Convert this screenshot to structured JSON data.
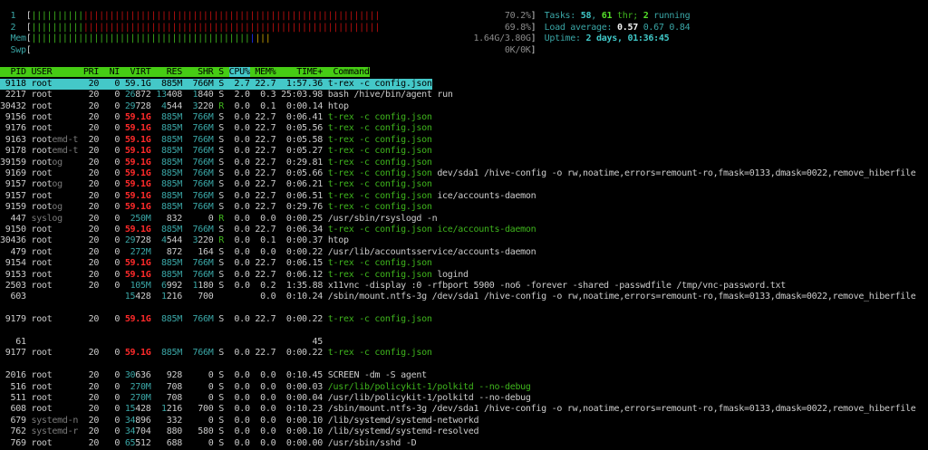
{
  "meters": {
    "cpu1": {
      "label": "1",
      "normal_pct": 10.4,
      "system_pct": 59.8,
      "text": "70.2%"
    },
    "cpu2": {
      "label": "2",
      "normal_pct": 10.4,
      "system_pct": 59.4,
      "text": "69.8%"
    },
    "mem": {
      "label": "Mem",
      "used_pct": 43.7,
      "buffers_pct": 1.0,
      "cache_pct": 3.1,
      "text": "1.64G/3.80G"
    },
    "swp": {
      "label": "Swp",
      "used_pct": 0,
      "text": "0K/0K"
    }
  },
  "summary": {
    "tasks_label": "Tasks: ",
    "tasks": "58",
    "thr": "61",
    "thr_label": " thr; ",
    "running": "2",
    "running_label": " running",
    "load_label": "Load average: ",
    "load1": "0.57",
    "load5": "0.67",
    "load15": "0.84",
    "uptime_label": "Uptime: ",
    "uptime": "2 days, 01:36:45"
  },
  "header": {
    "pid": "PID",
    "user": "USER",
    "pri": "PRI",
    "ni": "NI",
    "virt": "VIRT",
    "res": "RES",
    "shr": "SHR",
    "s": "S",
    "cpu": "CPU%",
    "mem": "MEM%",
    "time": "TIME+",
    "command": "Command"
  },
  "colors": {
    "header_bg": "#46cc14",
    "selected_bg": "#44c8c8",
    "thread": "#3fb51d",
    "big_mem": "#ff2a2a"
  },
  "processes": [
    {
      "line": 7,
      "selected": true,
      "pid": "9118",
      "user": "root",
      "pri": "20",
      "ni": "0",
      "virt": "59.1G",
      "res": "885M",
      "shr": "766M",
      "s": "S",
      "cpu": "2.7",
      "mem": "22.7",
      "time": "1:57.36",
      "cmd": "t-rex -c config.json"
    },
    {
      "line": 8,
      "pid": "2217",
      "user": "root",
      "pri": "20",
      "ni": "0",
      "virt": "26872",
      "res": "13408",
      "shr": "1840",
      "s": "S",
      "cpu": "2.0",
      "mem": "0.3",
      "time": "25:03.98",
      "cmd": "bash /hive/bin/agent run"
    },
    {
      "line": 9,
      "pid": "30432",
      "user": "root",
      "pri": "20",
      "ni": "0",
      "virt": "29728",
      "res": "4544",
      "shr": "3220",
      "s": "R",
      "cpu": "0.0",
      "mem": "0.1",
      "time": "0:00.14",
      "cmd": "htop"
    },
    {
      "line": 10,
      "thread": true,
      "pid": "9156",
      "user": "root",
      "pri": "20",
      "ni": "0",
      "virt": "59.1G",
      "res": "885M",
      "shr": "766M",
      "s": "S",
      "cpu": "0.0",
      "mem": "22.7",
      "time": "0:06.41",
      "cmd": "t-rex -c config.json"
    },
    {
      "line": 11,
      "thread": true,
      "pid": "9176",
      "user": "root",
      "pri": "20",
      "ni": "0",
      "virt": "59.1G",
      "res": "885M",
      "shr": "766M",
      "s": "S",
      "cpu": "0.0",
      "mem": "22.7",
      "time": "0:05.56",
      "cmd": "t-rex -c config.json"
    },
    {
      "line": 12,
      "thread": true,
      "pid": "9163",
      "user": "root",
      "user_ghost": "emd-t",
      "pri": "20",
      "ni": "0",
      "virt": "59.1G",
      "res": "885M",
      "shr": "766M",
      "s": "S",
      "cpu": "0.0",
      "mem": "22.7",
      "time": "0:05.58",
      "cmd": "t-rex -c config.json"
    },
    {
      "line": 13,
      "thread": true,
      "pid": "9178",
      "user": "root",
      "user_ghost": "emd-t",
      "pri": "20",
      "ni": "0",
      "virt": "59.1G",
      "res": "885M",
      "shr": "766M",
      "s": "S",
      "cpu": "0.0",
      "mem": "22.7",
      "time": "0:05.27",
      "cmd": "t-rex -c config.json"
    },
    {
      "line": 14,
      "thread": true,
      "pid": "39159",
      "user": "root",
      "user_ghost": "og",
      "pri": "20",
      "ni": "0",
      "virt": "59.1G",
      "res": "885M",
      "shr": "766M",
      "s": "S",
      "cpu": "0.0",
      "mem": "22.7",
      "time": "0:29.81",
      "cmd": "t-rex -c config.json"
    },
    {
      "line": 15,
      "thread": true,
      "pid": "9169",
      "user": "root",
      "pri": "20",
      "ni": "0",
      "virt": "59.1G",
      "res": "885M",
      "shr": "766M",
      "s": "S",
      "cpu": "0.0",
      "mem": "22.7",
      "time": "0:05.66",
      "cmd": "t-rex -c config.json",
      "cmd_extra": " dev/sda1 /hive-config -o rw,noatime,errors=remount-ro,fmask=0133,dmask=0022,remove_hiberfile"
    },
    {
      "line": 16,
      "thread": true,
      "pid": "9157",
      "user": "root",
      "user_ghost": "og",
      "pri": "20",
      "ni": "0",
      "virt": "59.1G",
      "res": "885M",
      "shr": "766M",
      "s": "S",
      "cpu": "0.0",
      "mem": "22.7",
      "time": "0:06.21",
      "cmd": "t-rex -c config.json"
    },
    {
      "line": 17,
      "thread": true,
      "pid": "9157",
      "user": "root",
      "pri": "20",
      "ni": "0",
      "virt": "59.1G",
      "res": "885M",
      "shr": "766M",
      "s": "S",
      "cpu": "0.0",
      "mem": "22.7",
      "time": "0:06.51",
      "cmd": "t-rex -c config.json",
      "cmd_extra": " ice/accounts-daemon"
    },
    {
      "line": 18,
      "thread": true,
      "pid": "9159",
      "user": "root",
      "user_ghost": "og",
      "pri": "20",
      "ni": "0",
      "virt": "59.1G",
      "res": "885M",
      "shr": "766M",
      "s": "S",
      "cpu": "0.0",
      "mem": "22.7",
      "time": "0:29.76",
      "cmd": "t-rex -c config.json"
    },
    {
      "line": 19,
      "pid": "447",
      "user": "syslog",
      "user_dim": true,
      "pri": "20",
      "ni": "0",
      "virt": "250M",
      "res": "832",
      "shr": "0",
      "s": "R",
      "cpu": "0.0",
      "mem": "0.0",
      "time": "0:00.25",
      "cmd": "/usr/sbin/rsyslogd -n"
    },
    {
      "line": 20,
      "thread": true,
      "extra_thread": true,
      "pid": "9150",
      "user": "root",
      "pri": "20",
      "ni": "0",
      "virt": "59.1G",
      "res": "885M",
      "shr": "766M",
      "s": "S",
      "cpu": "0.0",
      "mem": "22.7",
      "time": "0:06.34",
      "cmd": "t-rex -c config.json",
      "cmd_extra": " ice/accounts-daemon"
    },
    {
      "line": 21,
      "pid": "30436",
      "user": "root",
      "pri": "20",
      "ni": "0",
      "virt": "29728",
      "res": "4544",
      "shr": "3220",
      "s": "R",
      "cpu": "0.0",
      "mem": "0.1",
      "time": "0:00.37",
      "cmd": "htop"
    },
    {
      "line": 22,
      "pid": "479",
      "user": "root",
      "pri": "20",
      "ni": "0",
      "virt": "272M",
      "res": "872",
      "shr": "164",
      "s": "S",
      "cpu": "0.0",
      "mem": "0.0",
      "time": "0:00.22",
      "cmd": "/usr/lib/accountsservice/accounts-daemon"
    },
    {
      "line": 23,
      "thread": true,
      "pid": "9154",
      "user": "root",
      "pri": "20",
      "ni": "0",
      "virt": "59.1G",
      "res": "885M",
      "shr": "766M",
      "s": "S",
      "cpu": "0.0",
      "mem": "22.7",
      "time": "0:06.15",
      "cmd": "t-rex -c config.json"
    },
    {
      "line": 24,
      "thread": true,
      "pid": "9153",
      "user": "root",
      "pri": "20",
      "ni": "0",
      "virt": "59.1G",
      "res": "885M",
      "shr": "766M",
      "s": "S",
      "cpu": "0.0",
      "mem": "22.7",
      "time": "0:06.12",
      "cmd": "t-rex -c config.json",
      "cmd_extra": " logind"
    },
    {
      "line": 25,
      "pid": "2503",
      "user": "root",
      "pri": "20",
      "ni": "0",
      "virt": "105M",
      "res": "6992",
      "shr": "1180",
      "s": "S",
      "cpu": "0.0",
      "mem": "0.2",
      "time": "1:35.88",
      "cmd": "x11vnc -display :0 -rfbport 5900 -no6 -forever -shared -passwdfile /tmp/vnc-password.txt"
    },
    {
      "line": 26,
      "pid": "603",
      "user": "",
      "pri": "",
      "ni": "",
      "virt": "15428",
      "res": "1216",
      "shr": "700",
      "s": "",
      "cpu": "",
      "mem": "0.0",
      "time": "0:10.24",
      "cmd": "/sbin/mount.ntfs-3g /dev/sda1 /hive-config -o rw,noatime,errors=remount-ro,fmask=0133,dmask=0022,remove_hiberfile"
    },
    {
      "line": 28,
      "thread": true,
      "pid": "9179",
      "user": "root",
      "pri": "20",
      "ni": "0",
      "virt": "59.1G",
      "res": "885M",
      "shr": "766M",
      "s": "S",
      "cpu": "0.0",
      "mem": "22.7",
      "time": "0:00.22",
      "cmd": "t-rex -c config.json"
    },
    {
      "line": 30,
      "pid": "61",
      "user": "",
      "pri": "",
      "ni": "",
      "virt": "",
      "res": "",
      "shr": "",
      "s": "",
      "cpu": "",
      "mem": "",
      "time": "45",
      "cmd": ""
    },
    {
      "line": 31,
      "thread": true,
      "pid": "9177",
      "user": "root",
      "pri": "20",
      "ni": "0",
      "virt": "59.1G",
      "res": "885M",
      "shr": "766M",
      "s": "S",
      "cpu": "0.0",
      "mem": "22.7",
      "time": "0:00.22",
      "cmd": "t-rex -c config.json"
    },
    {
      "line": 33,
      "pid": "2016",
      "user": "root",
      "pri": "20",
      "ni": "0",
      "virt": "30636",
      "res": "928",
      "shr": "0",
      "s": "S",
      "cpu": "0.0",
      "mem": "0.0",
      "time": "0:10.45",
      "cmd": "SCREEN -dm -S agent"
    },
    {
      "line": 34,
      "thread": true,
      "pid": "516",
      "user": "root",
      "pri": "20",
      "ni": "0",
      "virt": "270M",
      "res": "708",
      "shr": "0",
      "s": "S",
      "cpu": "0.0",
      "mem": "0.0",
      "time": "0:00.03",
      "cmd": "/usr/lib/policykit-1/polkitd --no-debug"
    },
    {
      "line": 35,
      "pid": "511",
      "user": "root",
      "pri": "20",
      "ni": "0",
      "virt": "270M",
      "res": "708",
      "shr": "0",
      "s": "S",
      "cpu": "0.0",
      "mem": "0.0",
      "time": "0:00.04",
      "cmd": "/usr/lib/policykit-1/polkitd --no-debug"
    },
    {
      "line": 36,
      "pid": "608",
      "user": "root",
      "pri": "20",
      "ni": "0",
      "virt": "15428",
      "res": "1216",
      "shr": "700",
      "s": "S",
      "cpu": "0.0",
      "mem": "0.0",
      "time": "0:10.23",
      "cmd": "/sbin/mount.ntfs-3g /dev/sda1 /hive-config -o rw,noatime,errors=remount-ro,fmask=0133,dmask=0022,remove_hiberfile"
    },
    {
      "line": 37,
      "pid": "679",
      "user": "systemd-n",
      "user_dim": true,
      "pri": "20",
      "ni": "0",
      "virt": "34896",
      "res": "332",
      "shr": "0",
      "s": "S",
      "cpu": "0.0",
      "mem": "0.0",
      "time": "0:00.10",
      "cmd": "/lib/systemd/systemd-networkd"
    },
    {
      "line": 38,
      "pid": "762",
      "user": "systemd-r",
      "user_dim": true,
      "pri": "20",
      "ni": "0",
      "virt": "34704",
      "res": "880",
      "shr": "580",
      "s": "S",
      "cpu": "0.0",
      "mem": "0.0",
      "time": "0:00.10",
      "cmd": "/lib/systemd/systemd-resolved"
    },
    {
      "line": 39,
      "pid": "769",
      "user": "root",
      "pri": "20",
      "ni": "0",
      "virt": "65512",
      "res": "688",
      "shr": "0",
      "s": "S",
      "cpu": "0.0",
      "mem": "0.0",
      "time": "0:00.00",
      "cmd": "/usr/sbin/sshd -D"
    }
  ]
}
